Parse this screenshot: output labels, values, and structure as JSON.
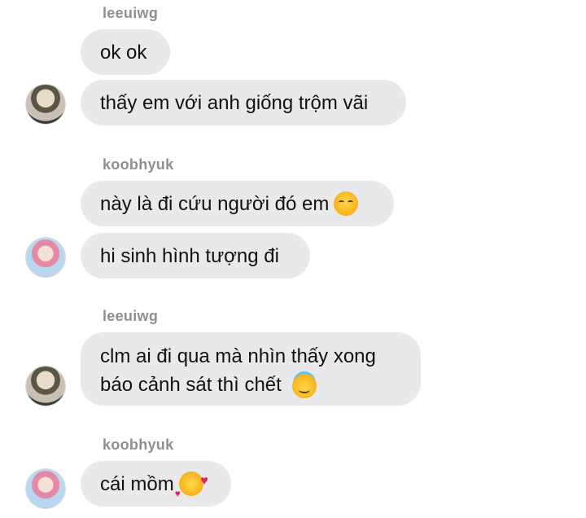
{
  "messages": [
    {
      "sender": "leeuiwg",
      "avatar": "avatar-leeuiwg",
      "bubbles": [
        {
          "text": "ok ok"
        },
        {
          "text": "thấy em với anh giống trộm vãi"
        }
      ]
    },
    {
      "sender": "koobhyuk",
      "avatar": "avatar-koobhyuk",
      "bubbles": [
        {
          "text": "này là đi cứu người đó em",
          "emoji": "smiling-face-icon"
        },
        {
          "text": "hi sinh hình tượng đi"
        }
      ]
    },
    {
      "sender": "leeuiwg",
      "avatar": "avatar-leeuiwg",
      "bubbles": [
        {
          "lines": [
            "clm ai đi qua mà nhìn thấy xong",
            "báo cảnh sát thì chết"
          ],
          "emoji": "halo-face-icon"
        }
      ]
    },
    {
      "sender": "koobhyuk",
      "avatar": "avatar-koobhyuk",
      "bubbles": [
        {
          "text": "cái mồm",
          "emoji": "smiling-face-with-hearts-icon"
        }
      ]
    }
  ],
  "colors": {
    "bubble": "#e9e9eb",
    "sender": "#8e8e93",
    "text": "#111111",
    "background": "#ffffff"
  }
}
